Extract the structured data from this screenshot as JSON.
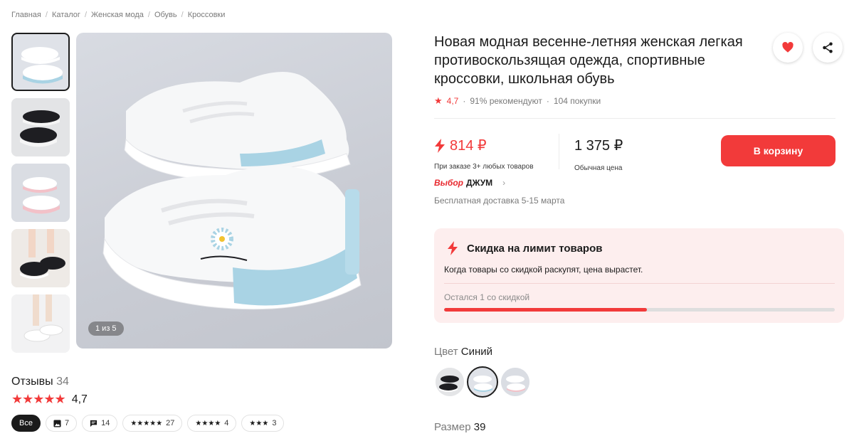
{
  "breadcrumb": [
    "Главная",
    "Каталог",
    "Женская мода",
    "Обувь",
    "Кроссовки"
  ],
  "gallery": {
    "counter": "1 из 5",
    "thumb_count": 5,
    "active_index": 0
  },
  "product": {
    "title": "Новая модная весенне-летняя женская легкая противоскользящая одежда, спортивные кроссовки, школьная обувь",
    "rating": "4,7",
    "recommend": "91% рекомендуют",
    "purchases": "104 покупки"
  },
  "actions": {
    "favorite_icon": "heart-icon",
    "share_icon": "share-icon"
  },
  "price": {
    "current": "814 ₽",
    "current_note": "При заказе 3+ любых товаров",
    "regular": "1 375 ₽",
    "regular_note": "Обычная цена",
    "cart_button": "В корзину"
  },
  "badge": {
    "vybor": "Выбор",
    "brand": "ДЖУМ",
    "delivery": "Бесплатная доставка 5-15 марта"
  },
  "limit": {
    "title": "Скидка на лимит товаров",
    "description": "Когда товары со скидкой раскупят, цена вырастет.",
    "remaining": "Остался 1 со скидкой",
    "progress_fraction": 0.52
  },
  "color": {
    "label": "Цвет",
    "value": "Синий",
    "options": 3,
    "selected_index": 1
  },
  "size": {
    "label": "Размер",
    "value": "39"
  },
  "reviews": {
    "title": "Отзывы",
    "count": "34",
    "rating": "4,7",
    "filters": [
      {
        "label": "Все",
        "icon": "",
        "active": true
      },
      {
        "label": "7",
        "icon": "image-icon"
      },
      {
        "label": "14",
        "icon": "comment-icon"
      },
      {
        "label": "27",
        "icon": "stars-5"
      },
      {
        "label": "4",
        "icon": "stars-4"
      },
      {
        "label": "3",
        "icon": "stars-3"
      }
    ]
  },
  "colors": {
    "accent": "#f23a3a",
    "limit_bg": "#fdeeee",
    "shoe_blue": "#a9d3e4"
  }
}
